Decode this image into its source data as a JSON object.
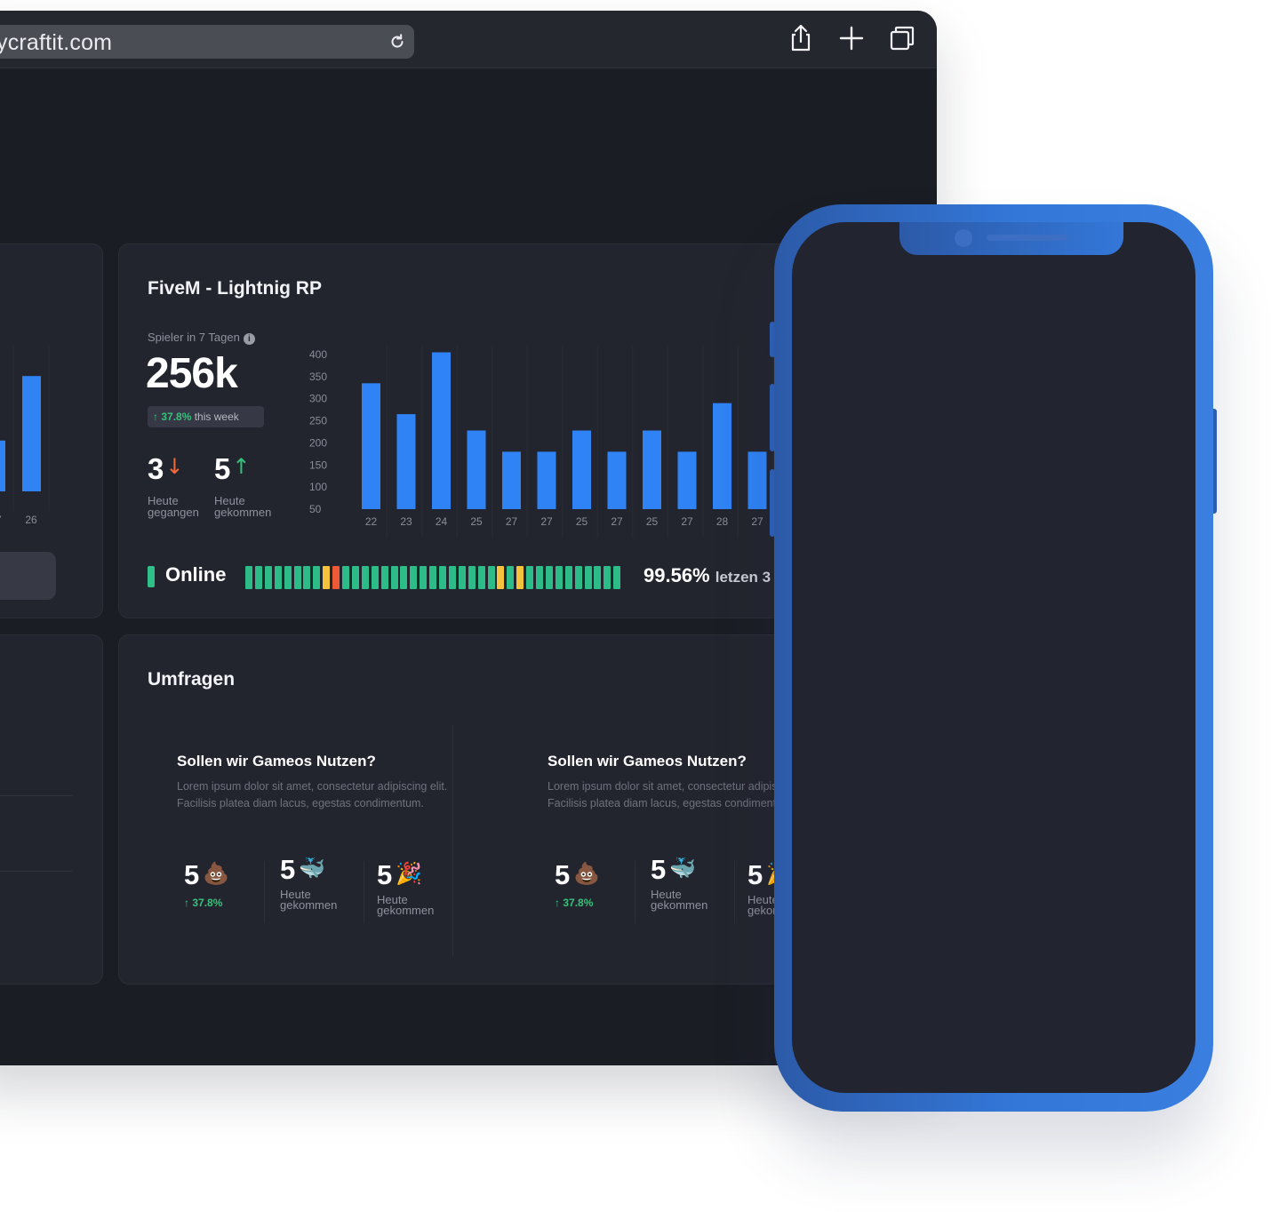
{
  "browser": {
    "url": "ycraftit.com"
  },
  "server_card": {
    "title": "FiveM - Lightnig RP",
    "stat_label": "Spieler in 7 Tagen",
    "info_icon": "i",
    "total_players": "256k",
    "growth_pct": "37.8%",
    "growth_suffix": "this week",
    "left_today": {
      "value": "3",
      "label_line1": "Heute",
      "label_line2": "gegangen"
    },
    "joined_today": {
      "value": "5",
      "label_line1": "Heute",
      "label_line2": "gekommen"
    },
    "online_label": "Online",
    "uptime_pct": "99.56%",
    "uptime_suffix": "letzen 3",
    "uptime_status": [
      "ok",
      "ok",
      "ok",
      "ok",
      "ok",
      "ok",
      "ok",
      "ok",
      "warn",
      "err",
      "ok",
      "ok",
      "ok",
      "ok",
      "ok",
      "ok",
      "ok",
      "ok",
      "ok",
      "ok",
      "ok",
      "ok",
      "ok",
      "ok",
      "ok",
      "ok",
      "warn",
      "ok",
      "warn",
      "ok",
      "ok",
      "ok",
      "ok",
      "ok",
      "ok",
      "ok",
      "ok",
      "ok",
      "ok",
      "ok"
    ],
    "colors": {
      "ok": "#2dbb87",
      "warn": "#f4c23c",
      "err": "#ee5a36",
      "bar": "#2f83f5"
    }
  },
  "chart_data": [
    {
      "type": "bar",
      "categories": [
        "22",
        "23",
        "24",
        "25",
        "27",
        "27",
        "25",
        "27",
        "25",
        "27",
        "28",
        "27"
      ],
      "values": [
        335,
        265,
        405,
        228,
        180,
        180,
        228,
        180,
        228,
        180,
        290,
        180
      ],
      "ylim": [
        50,
        400
      ],
      "yticks": [
        "400",
        "350",
        "300",
        "250",
        "200",
        "150",
        "100",
        "50"
      ],
      "grid": true
    },
    {
      "type": "bar",
      "categories": [
        "7",
        "27",
        "26"
      ],
      "values": [
        180,
        180,
        345
      ],
      "ylim": [
        50,
        400
      ]
    }
  ],
  "polls": {
    "title": "Umfragen",
    "items": [
      {
        "question": "Sollen wir Gameos Nutzen?",
        "description": "Lorem ipsum dolor sit amet, consectetur adipiscing elit. Facilisis platea diam lacus, egestas condimentum.",
        "votes": [
          {
            "value": "5",
            "emoji": "💩",
            "growth": "37.8%"
          },
          {
            "value": "5",
            "emoji": "🐳",
            "label_line1": "Heute",
            "label_line2": "gekommen"
          },
          {
            "value": "5",
            "emoji": "🎉",
            "label_line1": "Heute",
            "label_line2": "gekommen"
          }
        ]
      },
      {
        "question": "Sollen wir Gameos Nutzen?",
        "description": "Lorem ipsum dolor sit amet, consectetur adipiscing elit. Facilisis platea diam lacus, egestas condimentum.",
        "votes": [
          {
            "value": "5",
            "emoji": "💩",
            "growth": "37.8%"
          },
          {
            "value": "5",
            "emoji": "🐳",
            "label_line1": "Heute",
            "label_line2": "gekommen"
          },
          {
            "value": "5",
            "emoji": "🎉",
            "label_line1": "Heute",
            "label_line2": "gekommen"
          }
        ]
      }
    ]
  },
  "icons": {
    "reload": "reload-icon",
    "share": "share-icon",
    "new_tab": "plus-icon",
    "tabs": "tabs-icon"
  }
}
